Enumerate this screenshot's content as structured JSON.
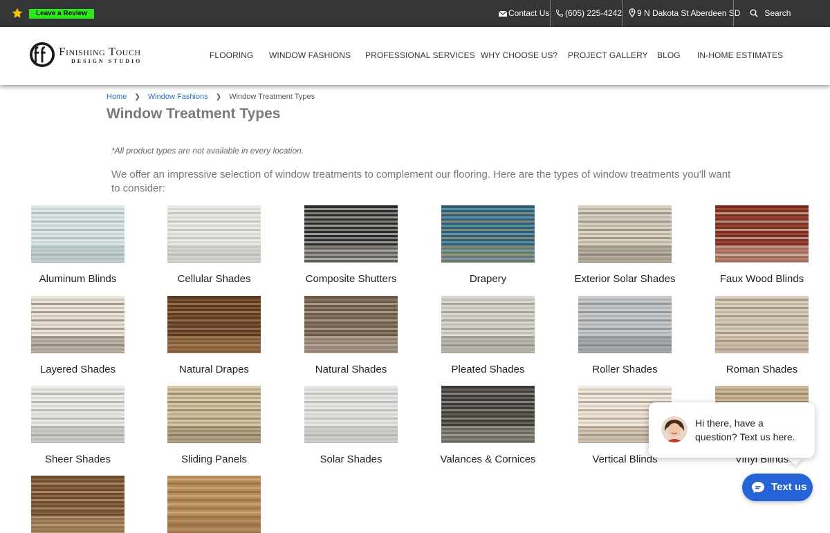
{
  "topbar": {
    "review_label": "Leave a Review",
    "contact_label": "Contact Us",
    "phone": "(605) 225-4242",
    "address": "9 N Dakota St Aberdeen SD",
    "search_label": "Search"
  },
  "logo": {
    "title": "Finishing Touch",
    "subtitle": "DESIGN STUDIO"
  },
  "nav": {
    "items": [
      "FLOORING",
      "WINDOW FASHIONS",
      "PROFESSIONAL SERVICES",
      "WHY CHOOSE US?",
      "PROJECT GALLERY",
      "BLOG",
      "IN-HOME ESTIMATES"
    ]
  },
  "breadcrumb": {
    "home": "Home",
    "section": "Window Fashions",
    "current": "Window Treatment Types"
  },
  "page": {
    "title": "Window Treatment Types",
    "disclaimer": "*All product types are not available in every location.",
    "intro": "We offer an impressive selection of window treatments to complement our flooring. Here are the types of window treatments you'll want to consider:"
  },
  "products": [
    "Aluminum Blinds",
    "Cellular Shades",
    "Composite Shutters",
    "Drapery",
    "Exterior Solar Shades",
    "Faux Wood Blinds",
    "Layered Shades",
    "Natural Drapes",
    "Natural Shades",
    "Pleated Shades",
    "Roller Shades",
    "Roman Shades",
    "Sheer Shades",
    "Sliding Panels",
    "Solar Shades",
    "Valances & Cornices",
    "Vertical Blinds",
    "Vinyl Blinds",
    "",
    ""
  ],
  "chat": {
    "message": "Hi there, have a question? Text us here.",
    "button_label": "Text us"
  },
  "colors": {
    "topbar": "#333537",
    "review_badge": "#2ee81f",
    "link": "#2a6ebb",
    "chat_button": "#2563d6"
  }
}
